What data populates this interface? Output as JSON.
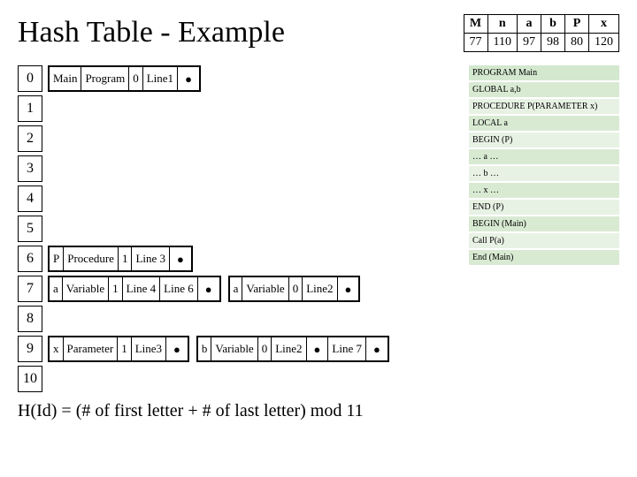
{
  "title": "Hash Table - Example",
  "addr": {
    "headers": [
      "M",
      "n",
      "a",
      "b",
      "P",
      "x"
    ],
    "values": [
      "77",
      "110",
      "97",
      "98",
      "80",
      "120"
    ]
  },
  "indices": [
    "0",
    "1",
    "2",
    "3",
    "4",
    "5",
    "6",
    "7",
    "8",
    "9",
    "10"
  ],
  "rows": {
    "r0": {
      "a": [
        "Main",
        "Program",
        "0",
        "Line1",
        "●"
      ]
    },
    "r6": {
      "a": [
        "P",
        "Procedure",
        "1",
        "Line 3",
        "●"
      ]
    },
    "r7": {
      "a": [
        "a",
        "Variable",
        "1",
        "Line 4",
        "Line 6",
        "●"
      ],
      "b": [
        "a",
        "Variable",
        "0",
        "Line2",
        "●"
      ]
    },
    "r9": {
      "a": [
        "x",
        "Parameter",
        "1",
        "Line3",
        "●"
      ],
      "b": [
        "b",
        "Variable",
        "0",
        "Line2",
        "●",
        "Line 7",
        "●"
      ]
    }
  },
  "code": [
    "PROGRAM Main",
    "GLOBAL a,b",
    "PROCEDURE P(PARAMETER x)",
    "LOCAL a",
    "BEGIN (P)",
    "… a …",
    "… b …",
    "… x …",
    "END (P)",
    "BEGIN (Main)",
    "Call P(a)",
    "End (Main)"
  ],
  "formula": "H(Id) = (# of first letter + # of last letter) mod 11"
}
